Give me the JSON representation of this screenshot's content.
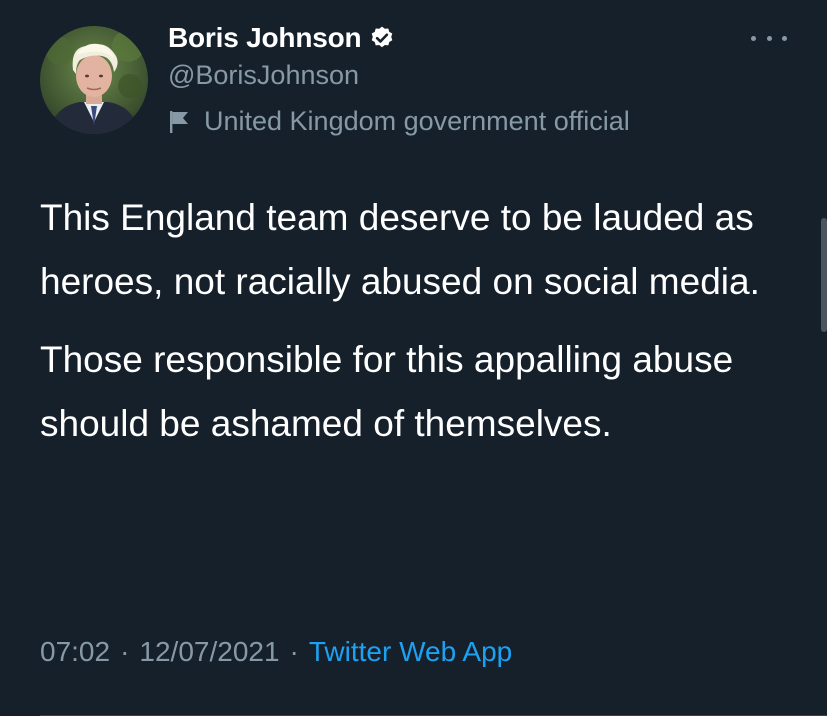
{
  "author": {
    "display_name": "Boris Johnson",
    "handle": "@BorisJohnson",
    "label": "United Kingdom government official",
    "avatar_icon": "profile-photo",
    "verified_icon": "verified-badge-icon",
    "label_icon": "flag-icon"
  },
  "tweet": {
    "paragraphs": [
      "This England team deserve to be lauded as heroes, not racially abused on social media.",
      "Those responsible for this appalling abuse should be ashamed of themselves."
    ],
    "time": "07:02",
    "date": "12/07/2021",
    "separator": "·",
    "source": "Twitter Web App"
  },
  "colors": {
    "background": "#15202b",
    "secondary_text": "#8899a6",
    "link": "#1da1f2",
    "primary_text": "#ffffff"
  }
}
